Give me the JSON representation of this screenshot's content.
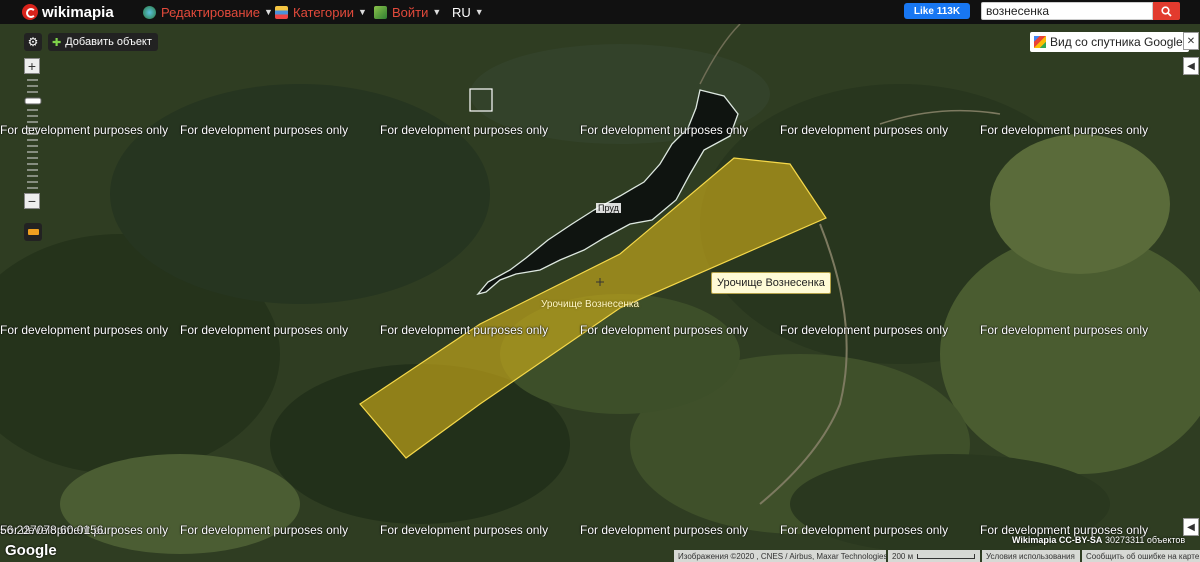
{
  "topbar": {
    "logo_text": "wikimapia",
    "menu_edit": "Редактирование",
    "menu_categories": "Категории",
    "menu_login": "Войти",
    "menu_lang": "RU",
    "fb_like": "Like 113K",
    "search_value": "вознесенка"
  },
  "map_controls": {
    "add_object": "Добавить объект",
    "satellite_view": "Вид со спутника Google"
  },
  "watermark_text": "For development purposes only",
  "coord_readout": "56.227078 60.0156",
  "labels": {
    "pond": "Пруд",
    "polygon": "Урочище Вознесенка",
    "tooltip": "Урочище Вознесенка"
  },
  "footer": {
    "google": "Google",
    "imagery": "Изображения ©2020 , CNES / Airbus, Maxar Technologies",
    "scale": "200 м",
    "terms": "Условия использования",
    "report": "Сообщить об ошибке на карте",
    "license": "Wikimapia CC-BY-SA",
    "object_count": "30273311 объектов"
  },
  "colors": {
    "polygon_fill": "#d4b21a",
    "accent_red": "#e24a3b",
    "facebook": "#1877f2"
  }
}
